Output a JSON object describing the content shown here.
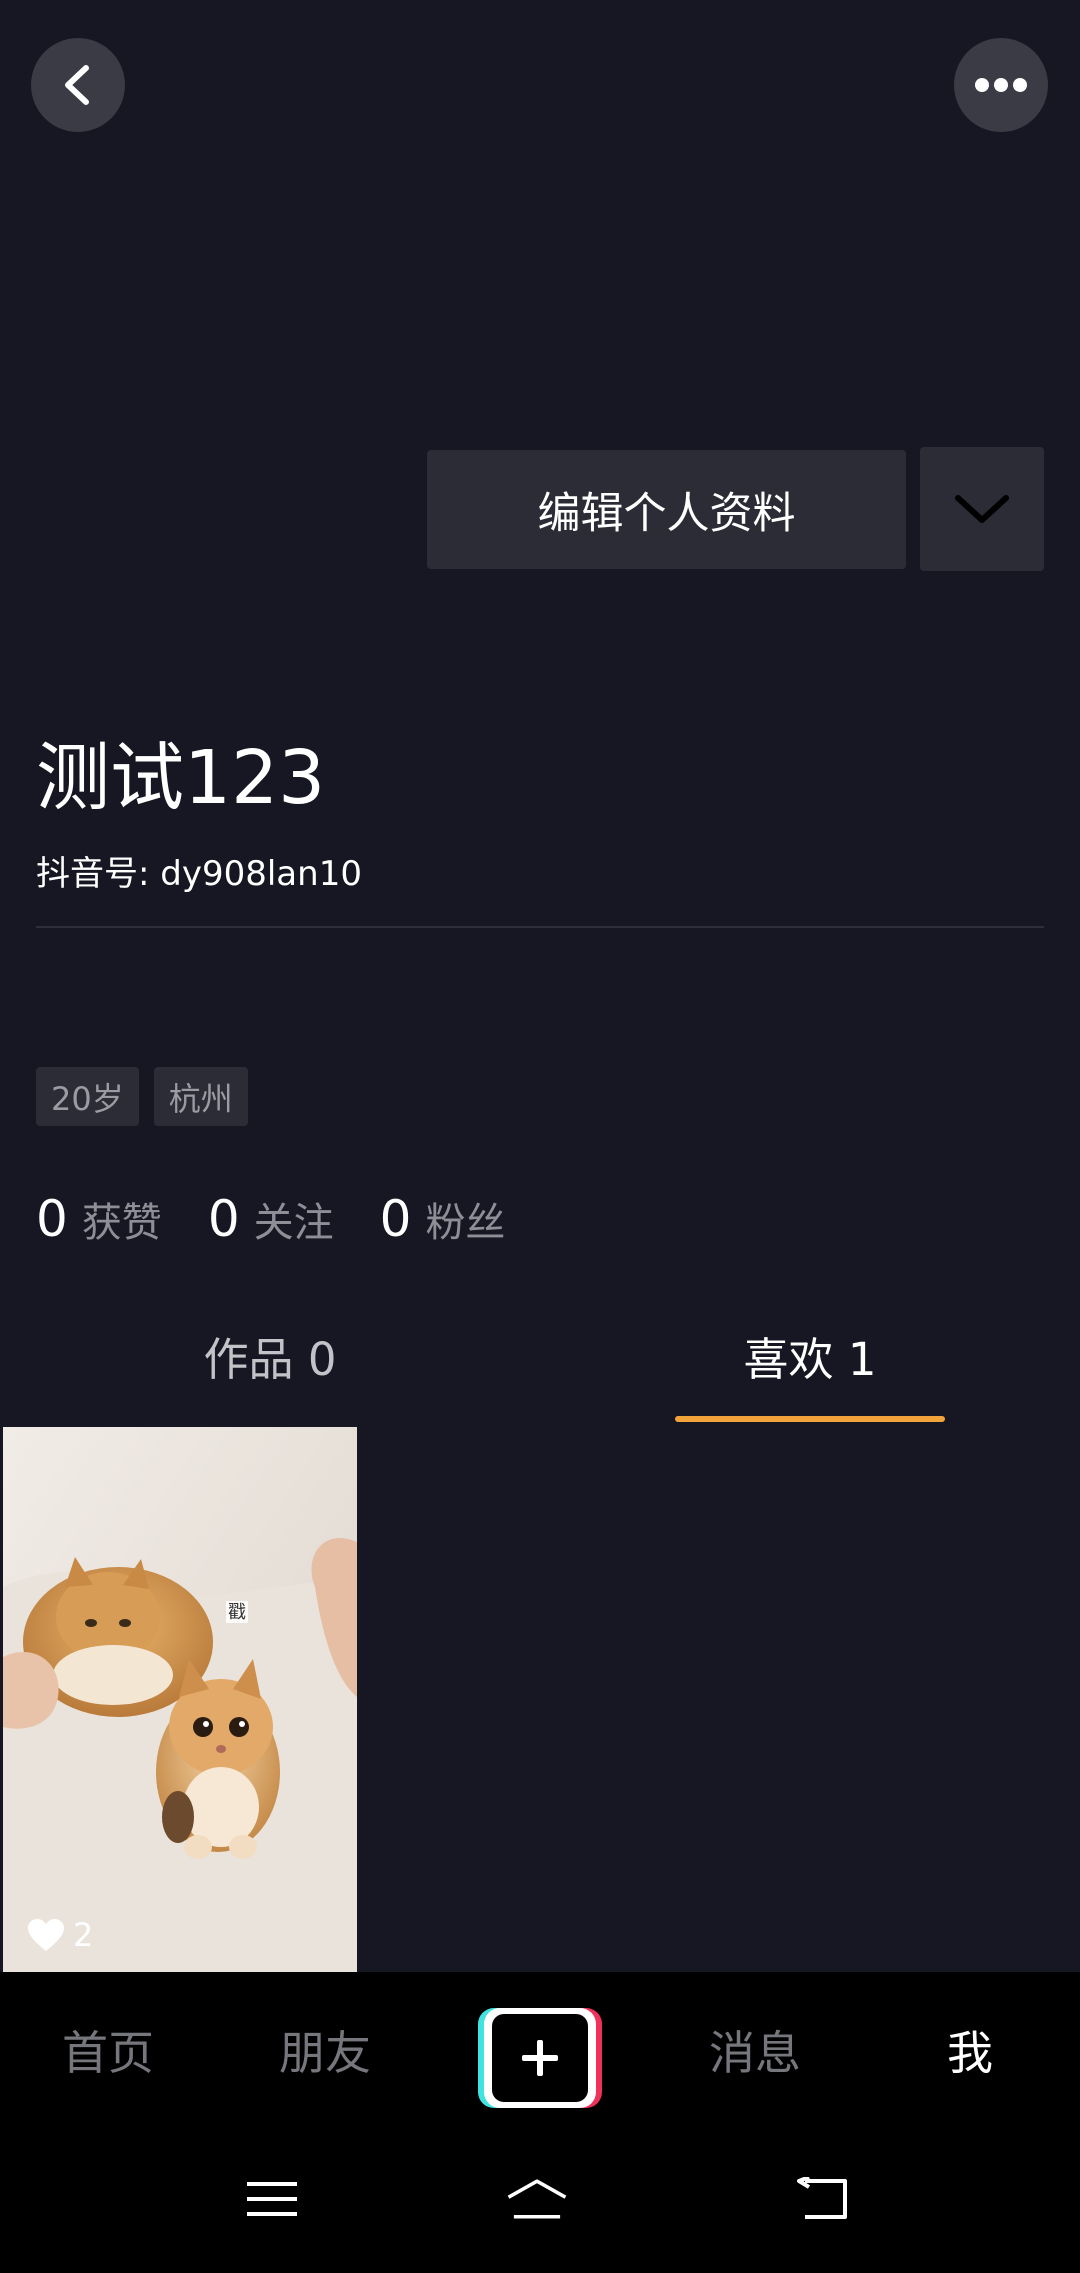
{
  "header": {
    "back_icon": "chevron-left-icon",
    "more_icon": "ellipsis-icon"
  },
  "profile": {
    "edit_label": "编辑个人资料",
    "expand_icon": "chevron-down-icon",
    "nickname": "测试123",
    "douyin_id": "抖音号: dy908lan10",
    "tags": [
      "20岁",
      "杭州"
    ],
    "stats": [
      {
        "num": "0",
        "label": "获赞"
      },
      {
        "num": "0",
        "label": "关注"
      },
      {
        "num": "0",
        "label": "粉丝"
      }
    ]
  },
  "tabs": {
    "works": "作品 0",
    "likes": "喜欢 1",
    "active": "likes",
    "accent": "#f2a33a"
  },
  "videos": [
    {
      "likes": "2",
      "overlay_text": "戳"
    }
  ],
  "bottom_nav": {
    "home": "首页",
    "friends": "朋友",
    "create_icon": "plus-icon",
    "messages": "消息",
    "me": "我"
  },
  "system_bar": {
    "menu_icon": "menu-icon",
    "home_icon": "home-icon",
    "back_icon": "back-icon"
  },
  "colors": {
    "background": "#161722",
    "button_bg": "#2b2c36",
    "plus_cyan": "#40e3e0",
    "plus_red": "#f0325a"
  }
}
